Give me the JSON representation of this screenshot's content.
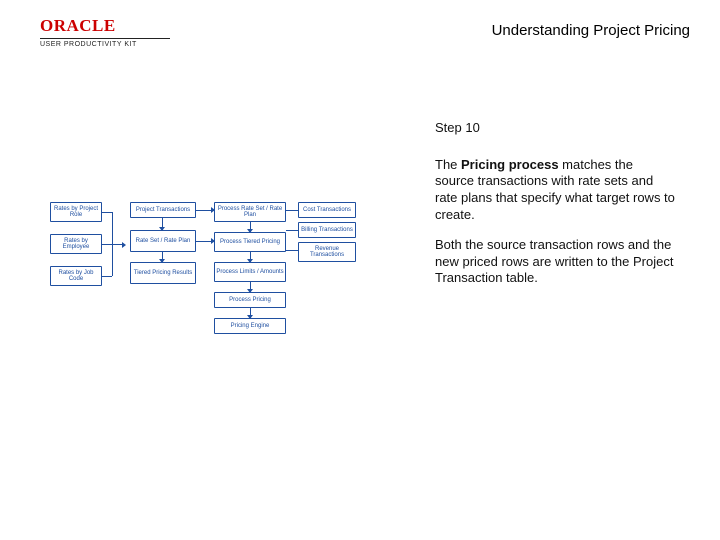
{
  "brand": {
    "name": "ORACLE",
    "sub": "USER PRODUCTIVITY KIT"
  },
  "title": "Understanding Project Pricing",
  "step_label": "Step 10",
  "body": {
    "p1_a": "The ",
    "p1_b": "Pricing process",
    "p1_c": " matches the source transactions with rate sets and rate plans that specify what target rows to create.",
    "p2": "Both the source transaction rows and the new priced rows are written to the Project Transaction table."
  },
  "diagram": {
    "col1": {
      "role": "Rates by Project Role",
      "emp": "Rates by Employee",
      "job": "Rates by Job Code"
    },
    "col2": {
      "proj": "Project Transactions",
      "plan": "Rate Set / Rate Plan",
      "write": "Tiered Pricing Results"
    },
    "col3": {
      "rateplan": "Process Rate Set / Rate Plan",
      "tiered": "Process Tiered Pricing",
      "attr": "Process Limits / Amounts",
      "disc": "Process Pricing",
      "engine": "Pricing Engine"
    },
    "col4": {
      "get": "Cost Transactions",
      "blg": "Billing Transactions",
      "sum": "Revenue Transactions"
    }
  }
}
